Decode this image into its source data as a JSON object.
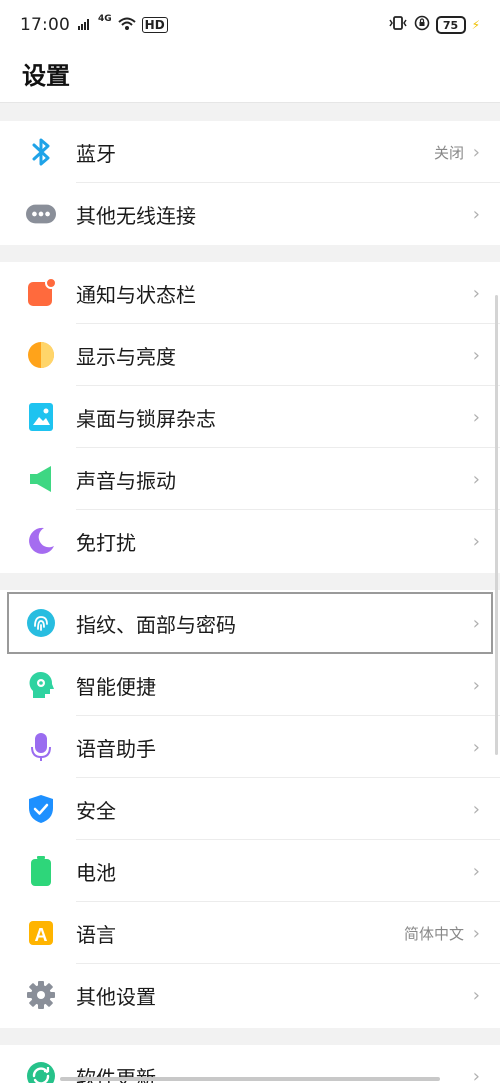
{
  "status": {
    "time": "17:00",
    "network": "4G",
    "wifi_label": "HD",
    "battery": "75"
  },
  "header": {
    "title": "设置"
  },
  "rows": [
    {
      "label": "蓝牙",
      "value": "关闭",
      "icon": "bluetooth-icon"
    },
    {
      "label": "其他无线连接",
      "value": "",
      "icon": "more-connections-icon"
    },
    {
      "label": "通知与状态栏",
      "value": "",
      "icon": "notification-icon"
    },
    {
      "label": "显示与亮度",
      "value": "",
      "icon": "display-icon"
    },
    {
      "label": "桌面与锁屏杂志",
      "value": "",
      "icon": "wallpaper-icon"
    },
    {
      "label": "声音与振动",
      "value": "",
      "icon": "sound-icon"
    },
    {
      "label": "免打扰",
      "value": "",
      "icon": "moon-icon"
    },
    {
      "label": "指纹、面部与密码",
      "value": "",
      "icon": "fingerprint-icon"
    },
    {
      "label": "智能便捷",
      "value": "",
      "icon": "smart-icon"
    },
    {
      "label": "语音助手",
      "value": "",
      "icon": "microphone-icon"
    },
    {
      "label": "安全",
      "value": "",
      "icon": "shield-icon"
    },
    {
      "label": "电池",
      "value": "",
      "icon": "battery-icon"
    },
    {
      "label": "语言",
      "value": "简体中文",
      "icon": "language-icon"
    },
    {
      "label": "其他设置",
      "value": "",
      "icon": "gear-icon"
    },
    {
      "label": "软件更新",
      "value": "",
      "icon": "update-icon"
    }
  ],
  "chevron": "›",
  "colors": {
    "bluetooth": "#1fa3e8",
    "notification": "#ff6a3d",
    "display": "#ffa31a",
    "wallpaper": "#1ec3f0",
    "sound": "#3ed783",
    "moon": "#a56cf0",
    "fingerprint": "#28bde0",
    "smart": "#2fd3a0",
    "microphone": "#9a6cf0",
    "shield": "#1e90ff",
    "battery": "#2ed67a",
    "language": "#ffb400",
    "gear": "#8a8f99",
    "update": "#26c28a"
  }
}
